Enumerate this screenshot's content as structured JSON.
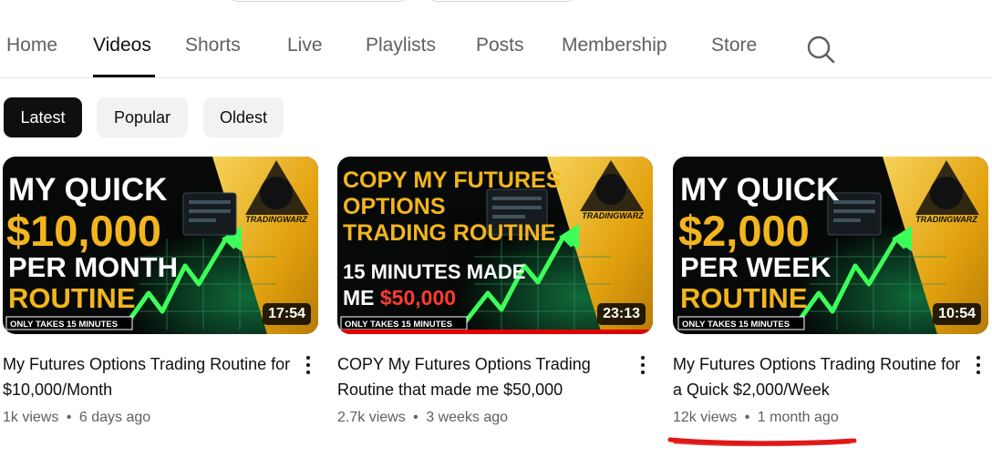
{
  "tabs": [
    {
      "label": "Home"
    },
    {
      "label": "Videos"
    },
    {
      "label": "Shorts"
    },
    {
      "label": "Live"
    },
    {
      "label": "Playlists"
    },
    {
      "label": "Posts"
    },
    {
      "label": "Membership"
    },
    {
      "label": "Store"
    }
  ],
  "active_tab": "Videos",
  "search_icon": "search-icon",
  "chips": [
    {
      "label": "Latest"
    },
    {
      "label": "Popular"
    },
    {
      "label": "Oldest"
    }
  ],
  "active_chip": "Latest",
  "videos": [
    {
      "title": "My Futures Options Trading Routine for $10,000/Month",
      "views": "1k views",
      "age": "6 days ago",
      "duration": "17:54",
      "thumb": {
        "line1": "MY QUICK",
        "line2": "$10,000",
        "line3": "PER MONTH",
        "line4": "ROUTINE",
        "footer": "ONLY TAKES 15 MINUTES",
        "brand": "TRADINGWARZ"
      }
    },
    {
      "title": "COPY My Futures Options Trading Routine that made me $50,000",
      "views": "2.7k views",
      "age": "3 weeks ago",
      "duration": "23:13",
      "progress": 1.0,
      "thumb": {
        "line1": "COPY MY FUTURES",
        "line2": "OPTIONS",
        "line3": "TRADING ROUTINE",
        "line4": "15 MINUTES MADE",
        "line5a": "ME ",
        "line5b": "$50,000",
        "footer": "ONLY TAKES 15 MINUTES",
        "brand": "TRADINGWARZ"
      }
    },
    {
      "title": "My Futures Options Trading Routine for a Quick $2,000/Week",
      "views": "12k views",
      "age": "1 month ago",
      "duration": "10:54",
      "thumb": {
        "line1": "MY QUICK",
        "line2": "$2,000",
        "line3": "PER WEEK",
        "line4": "ROUTINE",
        "footer": "ONLY TAKES 15 MINUTES",
        "brand": "TRADINGWARZ"
      }
    }
  ],
  "meta_separator": "•",
  "colors": {
    "accent_gold": "#f2b51d",
    "progress_red": "#e00000",
    "annotation_red": "#e01818"
  }
}
